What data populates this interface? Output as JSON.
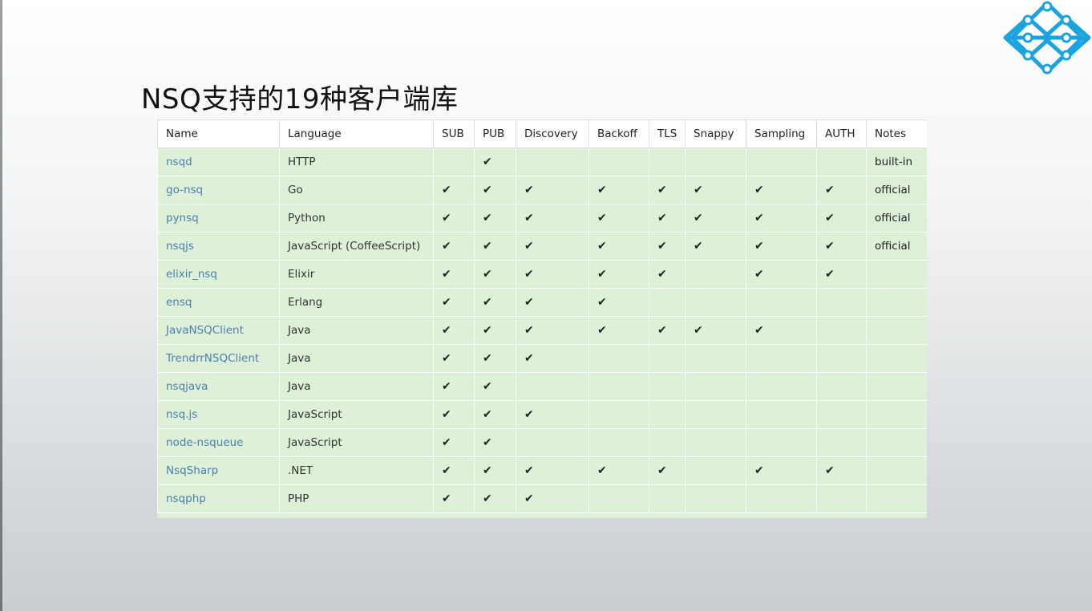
{
  "slide": {
    "title": "NSQ支持的19种客户端库",
    "logo_icon": "diamond-network-logo",
    "accent_color": "#1aa3de"
  },
  "table": {
    "headers": [
      "Name",
      "Language",
      "SUB",
      "PUB",
      "Discovery",
      "Backoff",
      "TLS",
      "Snappy",
      "Sampling",
      "AUTH",
      "Notes"
    ],
    "check_glyph": "✔",
    "rows": [
      {
        "name": "nsqd",
        "language": "HTTP",
        "sub": false,
        "pub": true,
        "discovery": false,
        "backoff": false,
        "tls": false,
        "snappy": false,
        "sampling": false,
        "auth": false,
        "notes": "built-in"
      },
      {
        "name": "go-nsq",
        "language": "Go",
        "sub": true,
        "pub": true,
        "discovery": true,
        "backoff": true,
        "tls": true,
        "snappy": true,
        "sampling": true,
        "auth": true,
        "notes": "official"
      },
      {
        "name": "pynsq",
        "language": "Python",
        "sub": true,
        "pub": true,
        "discovery": true,
        "backoff": true,
        "tls": true,
        "snappy": true,
        "sampling": true,
        "auth": true,
        "notes": "official"
      },
      {
        "name": "nsqjs",
        "language": "JavaScript (CoffeeScript)",
        "sub": true,
        "pub": true,
        "discovery": true,
        "backoff": true,
        "tls": true,
        "snappy": true,
        "sampling": true,
        "auth": true,
        "notes": "official"
      },
      {
        "name": "elixir_nsq",
        "language": "Elixir",
        "sub": true,
        "pub": true,
        "discovery": true,
        "backoff": true,
        "tls": true,
        "snappy": false,
        "sampling": true,
        "auth": true,
        "notes": ""
      },
      {
        "name": "ensq",
        "language": "Erlang",
        "sub": true,
        "pub": true,
        "discovery": true,
        "backoff": true,
        "tls": false,
        "snappy": false,
        "sampling": false,
        "auth": false,
        "notes": ""
      },
      {
        "name": "JavaNSQClient",
        "language": "Java",
        "sub": true,
        "pub": true,
        "discovery": true,
        "backoff": true,
        "tls": true,
        "snappy": true,
        "sampling": true,
        "auth": false,
        "notes": ""
      },
      {
        "name": "TrendrrNSQClient",
        "language": "Java",
        "sub": true,
        "pub": true,
        "discovery": true,
        "backoff": false,
        "tls": false,
        "snappy": false,
        "sampling": false,
        "auth": false,
        "notes": ""
      },
      {
        "name": "nsqjava",
        "language": "Java",
        "sub": true,
        "pub": true,
        "discovery": false,
        "backoff": false,
        "tls": false,
        "snappy": false,
        "sampling": false,
        "auth": false,
        "notes": ""
      },
      {
        "name": "nsq.js",
        "language": "JavaScript",
        "sub": true,
        "pub": true,
        "discovery": true,
        "backoff": false,
        "tls": false,
        "snappy": false,
        "sampling": false,
        "auth": false,
        "notes": ""
      },
      {
        "name": "node-nsqueue",
        "language": "JavaScript",
        "sub": true,
        "pub": true,
        "discovery": false,
        "backoff": false,
        "tls": false,
        "snappy": false,
        "sampling": false,
        "auth": false,
        "notes": ""
      },
      {
        "name": "NsqSharp",
        "language": ".NET",
        "sub": true,
        "pub": true,
        "discovery": true,
        "backoff": true,
        "tls": true,
        "snappy": false,
        "sampling": true,
        "auth": true,
        "notes": ""
      },
      {
        "name": "nsqphp",
        "language": "PHP",
        "sub": true,
        "pub": true,
        "discovery": true,
        "backoff": false,
        "tls": false,
        "snappy": false,
        "sampling": false,
        "auth": false,
        "notes": ""
      }
    ]
  }
}
